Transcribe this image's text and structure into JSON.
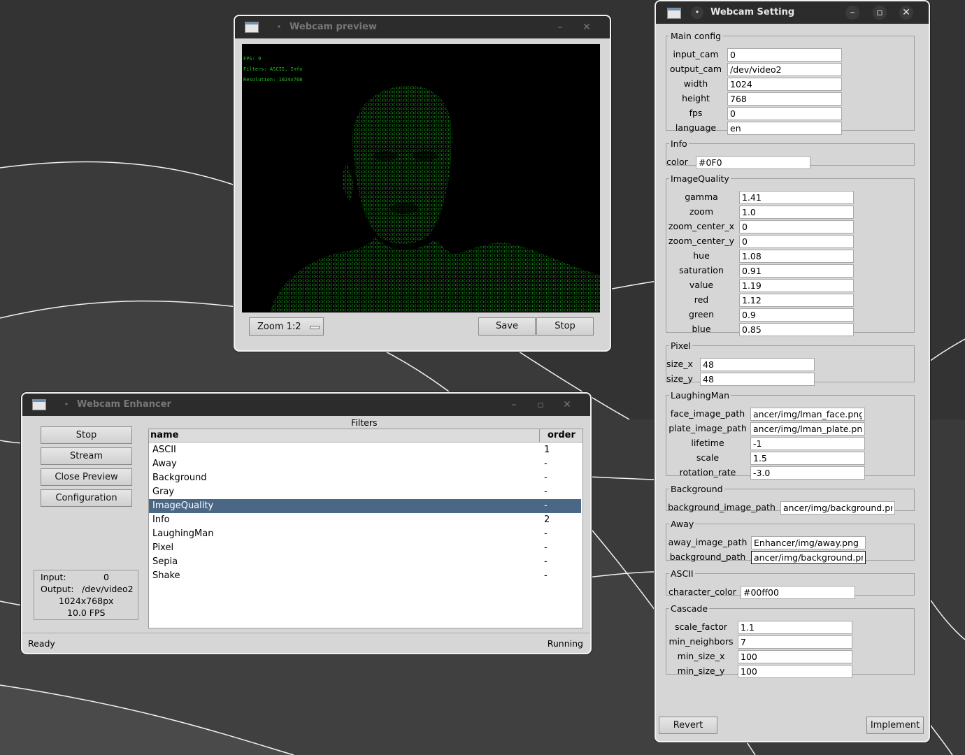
{
  "preview_window": {
    "title": "Webcam preview",
    "overlay": [
      "FPS: 9",
      "Filters: ASCII, Info",
      "Resolution: 1024x768"
    ],
    "zoom_value": "Zoom 1:2",
    "save_label": "Save",
    "stop_label": "Stop",
    "icons": {
      "pin": "•",
      "minimize": "–",
      "close": "✕"
    }
  },
  "enhancer_window": {
    "title": "Webcam Enhancer",
    "buttons": [
      "Stop",
      "Stream",
      "Close Preview",
      "Configuration"
    ],
    "status": {
      "input_label": "Input:",
      "input_value": "0",
      "output_label": "Output:",
      "output_value": "/dev/video2",
      "resolution": "1024x768px",
      "fps": "10.0 FPS"
    },
    "filters_caption": "Filters",
    "columns": {
      "name": "name",
      "order": "order"
    },
    "filters": [
      {
        "name": "ASCII",
        "order": "1"
      },
      {
        "name": "Away",
        "order": "-"
      },
      {
        "name": "Background",
        "order": "-"
      },
      {
        "name": "Gray",
        "order": "-"
      },
      {
        "name": "ImageQuality",
        "order": "-"
      },
      {
        "name": "Info",
        "order": "2"
      },
      {
        "name": "LaughingMan",
        "order": "-"
      },
      {
        "name": "Pixel",
        "order": "-"
      },
      {
        "name": "Sepia",
        "order": "-"
      },
      {
        "name": "Shake",
        "order": "-"
      }
    ],
    "selected_filter": "ImageQuality",
    "status_left": "Ready",
    "status_right": "Running",
    "icons": {
      "pin": "•",
      "minimize": "–",
      "maximize": "▫",
      "close": "✕"
    }
  },
  "settings_window": {
    "title": "Webcam Setting",
    "icons": {
      "pin": "•",
      "minimize": "–",
      "maximize": "▫",
      "close": "✕"
    },
    "groups": [
      {
        "title": "Main config",
        "fields": [
          {
            "label": "input_cam",
            "value": "0"
          },
          {
            "label": "output_cam",
            "value": "/dev/video2"
          },
          {
            "label": "width",
            "value": "1024"
          },
          {
            "label": "height",
            "value": "768"
          },
          {
            "label": "fps",
            "value": "0"
          },
          {
            "label": "language",
            "value": "en"
          }
        ]
      },
      {
        "title": "Info",
        "fields": [
          {
            "label": "color",
            "value": "#0F0"
          }
        ]
      },
      {
        "title": "ImageQuality",
        "fields": [
          {
            "label": "gamma",
            "value": "1.41"
          },
          {
            "label": "zoom",
            "value": "1.0"
          },
          {
            "label": "zoom_center_x",
            "value": "0"
          },
          {
            "label": "zoom_center_y",
            "value": "0"
          },
          {
            "label": "hue",
            "value": "1.08"
          },
          {
            "label": "saturation",
            "value": "0.91"
          },
          {
            "label": "value",
            "value": "1.19"
          },
          {
            "label": "red",
            "value": "1.12"
          },
          {
            "label": "green",
            "value": "0.9"
          },
          {
            "label": "blue",
            "value": "0.85"
          }
        ]
      },
      {
        "title": "Pixel",
        "fields": [
          {
            "label": "size_x",
            "value": "48"
          },
          {
            "label": "size_y",
            "value": "48"
          }
        ]
      },
      {
        "title": "LaughingMan",
        "fields": [
          {
            "label": "face_image_path",
            "value": "ancer/img/lman_face.png"
          },
          {
            "label": "plate_image_path",
            "value": "ancer/img/lman_plate.png"
          },
          {
            "label": "lifetime",
            "value": "-1"
          },
          {
            "label": "scale",
            "value": "1.5"
          },
          {
            "label": "rotation_rate",
            "value": "-3.0"
          }
        ]
      },
      {
        "title": "Background",
        "fields": [
          {
            "label": "background_image_path",
            "value": "ancer/img/background.png"
          }
        ]
      },
      {
        "title": "Away",
        "fields": [
          {
            "label": "away_image_path",
            "value": "Enhancer/img/away.png"
          },
          {
            "label": "background_path",
            "value": "ancer/img/background.png"
          }
        ]
      },
      {
        "title": "ASCII",
        "fields": [
          {
            "label": "character_color",
            "value": "#00ff00"
          }
        ]
      },
      {
        "title": "Cascade",
        "fields": [
          {
            "label": "scale_factor",
            "value": "1.1"
          },
          {
            "label": "min_neighbors",
            "value": "7"
          },
          {
            "label": "min_size_x",
            "value": "100"
          },
          {
            "label": "min_size_y",
            "value": "100"
          }
        ]
      }
    ],
    "revert_label": "Revert",
    "implement_label": "Implement"
  },
  "colors": {
    "desktop": "#3a3a3a",
    "titlebar": "#2c2c2c",
    "window_body": "#d6d6d6",
    "selection": "#4a6886",
    "ascii_green": "#1ec81e"
  }
}
